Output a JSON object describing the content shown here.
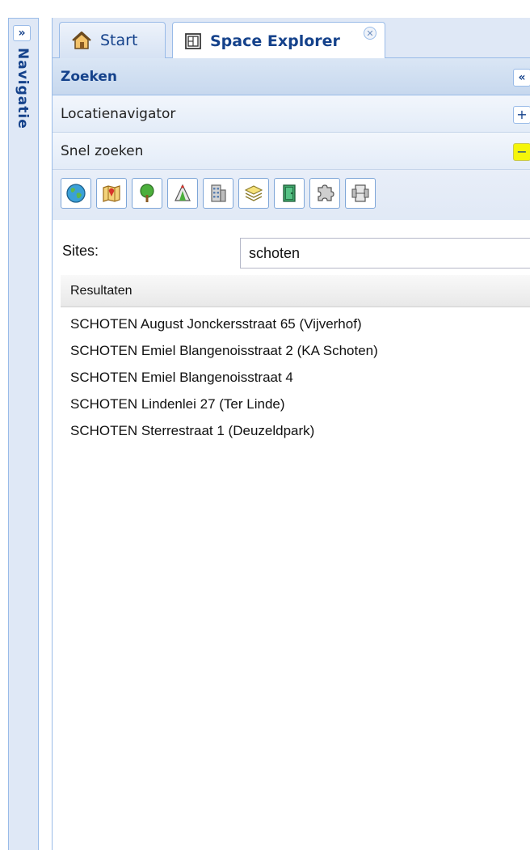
{
  "navigation": {
    "title": "Navigatie",
    "expand_glyph": "»"
  },
  "tabs": [
    {
      "label": "Start",
      "icon": "home-icon"
    },
    {
      "label": "Space Explorer",
      "icon": "floorplan-icon",
      "active": true,
      "close_glyph": "✕"
    }
  ],
  "zoeken": {
    "title": "Zoeken",
    "collapse_glyph": "«"
  },
  "sections": {
    "locatienavigator": {
      "title": "Locatienavigator",
      "tool_glyph": "+"
    },
    "snel_zoeken": {
      "title": "Snel zoeken",
      "tool_glyph": "−"
    }
  },
  "toolbar_icons": [
    "globe-icon",
    "map-icon",
    "tree-icon",
    "campsite-icon",
    "building-icon",
    "layers-icon",
    "door-icon",
    "puzzle-icon",
    "furniture-icon"
  ],
  "sites": {
    "label": "Sites:",
    "value": "schoten"
  },
  "results": {
    "header": "Resultaten",
    "items": [
      "SCHOTEN August Jonckersstraat 65 (Vijverhof)",
      "SCHOTEN Emiel Blangenoisstraat 2 (KA Schoten)",
      "SCHOTEN Emiel Blangenoisstraat 4",
      "SCHOTEN Lindenlei 27 (Ter Linde)",
      "SCHOTEN Sterrestraat 1 (Deuzeldpark)"
    ]
  },
  "colors": {
    "panel_blue": "#dfe8f6",
    "border_blue": "#99bbe8",
    "title_blue": "#15428b",
    "highlight_yellow": "#f5f50a"
  }
}
